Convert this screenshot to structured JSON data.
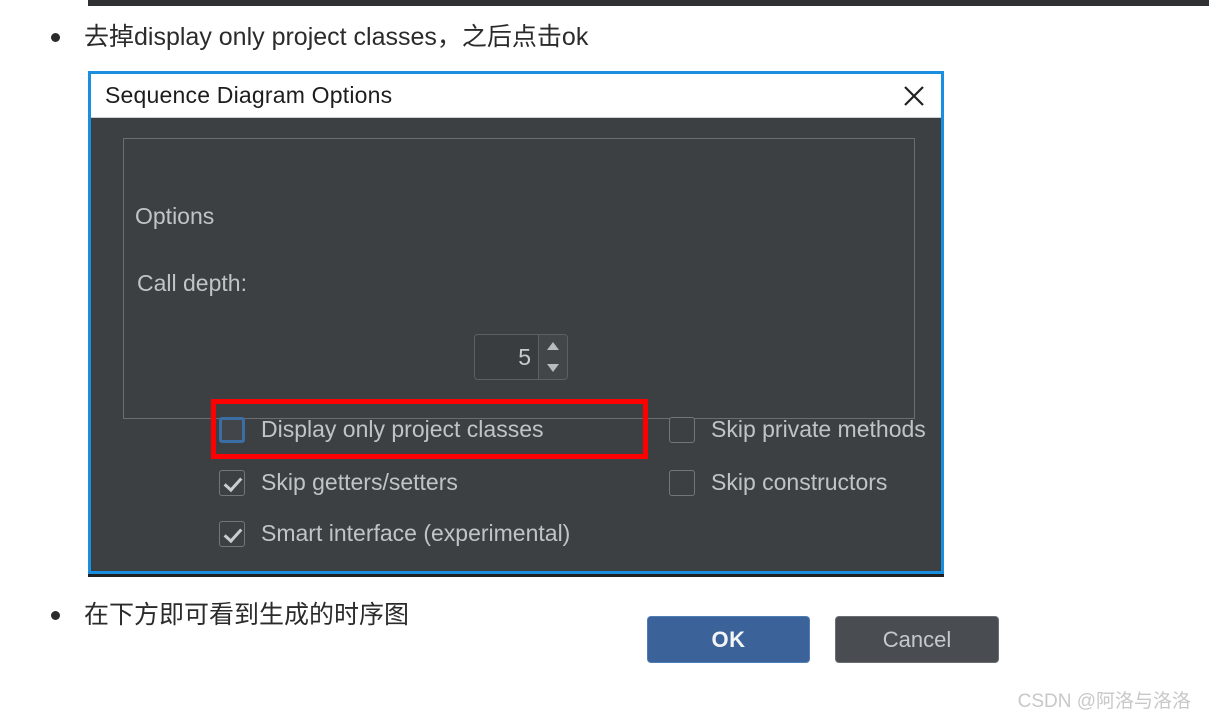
{
  "page": {
    "bullets": [
      {
        "text": "去掉display only project classes，之后点击ok"
      },
      {
        "text": "在下方即可看到生成的时序图"
      }
    ],
    "watermark": "CSDN @阿洛与洛洛"
  },
  "dialog": {
    "title": "Sequence Diagram Options",
    "close_icon": "close-icon",
    "group": {
      "legend": "Options",
      "call_depth": {
        "label": "Call depth:",
        "value": "5",
        "increment_icon": "chevron-up-icon",
        "decrement_icon": "chevron-down-icon"
      },
      "checkboxes": [
        {
          "label": "Display only project classes",
          "checked": false,
          "focused": true
        },
        {
          "label": "Skip getters/setters",
          "checked": true,
          "focused": false
        },
        {
          "label": "Smart interface (experimental)",
          "checked": true,
          "focused": false
        },
        {
          "label": "Skip private methods",
          "checked": false,
          "focused": false
        },
        {
          "label": "Skip constructors",
          "checked": false,
          "focused": false
        }
      ]
    },
    "buttons": {
      "ok": "OK",
      "cancel": "Cancel"
    }
  },
  "colors": {
    "dialog_border": "#1a8fe0",
    "dialog_background": "#3c4043",
    "titlebar_background": "#ffffff",
    "text_primary": "#bfc4c8",
    "ok_button": "#3c6399",
    "annotation_highlight": "#ff0000",
    "checkbox_focus": "#3b6ea5"
  }
}
